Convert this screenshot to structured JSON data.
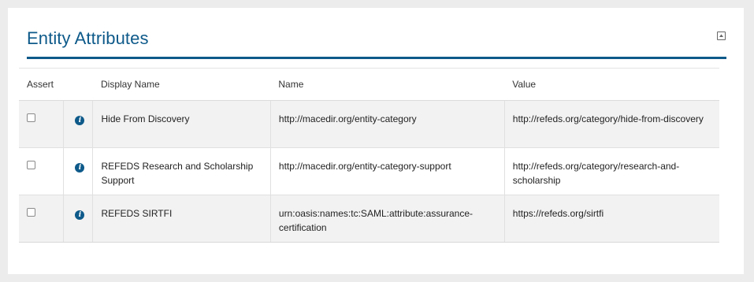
{
  "panel": {
    "title": "Entity Attributes",
    "collapse_icon": "collapse-up-icon"
  },
  "table": {
    "columns": [
      "Assert",
      "",
      "Display Name",
      "Name",
      "Value"
    ],
    "rows": [
      {
        "display_name": "Hide From Discovery",
        "name": "http://macedir.org/entity-category",
        "value": "http://refeds.org/category/hide-from-discovery",
        "asserted": false,
        "info_icon": "i"
      },
      {
        "display_name": "REFEDS Research and Scholarship Support",
        "name": "http://macedir.org/entity-category-support",
        "value": "http://refeds.org/category/research-and-scholarship",
        "asserted": false,
        "info_icon": "i"
      },
      {
        "display_name": "REFEDS SIRTFI",
        "name": "urn:oasis:names:tc:SAML:attribute:assurance-certification",
        "value": "https://refeds.org/sirtfi",
        "asserted": false,
        "info_icon": "i"
      }
    ]
  },
  "colors": {
    "accent": "#0e5a8a",
    "row_shade": "#f2f2f2",
    "background": "#ececec"
  }
}
